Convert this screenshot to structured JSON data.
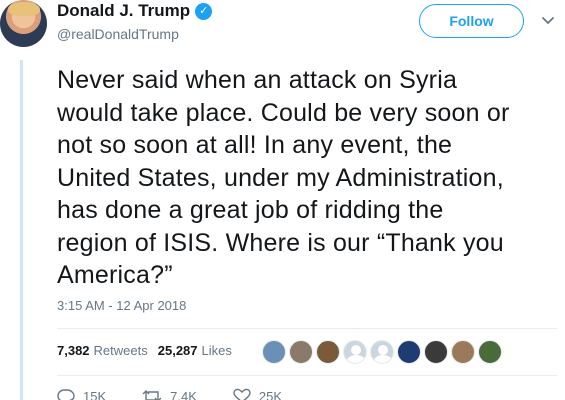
{
  "user": {
    "name": "Donald J. Trump",
    "handle": "@realDonaldTrump",
    "verified_mark": "✓"
  },
  "follow_label": "Follow",
  "tweet": {
    "lines": [
      "Never said when an attack on Syria",
      "would take place. Could be very soon or",
      "not so soon at all! In any event, the",
      "United States, under my Administration,",
      "has done a great job of ridding the",
      "region of ISIS. Where is our “Thank you",
      "America?”"
    ],
    "timestamp": "3:15 AM - 12 Apr 2018"
  },
  "stats": {
    "retweets_count": "7,382",
    "retweets_label": "Retweets",
    "likes_count": "25,287",
    "likes_label": "Likes"
  },
  "likers": [
    {
      "color": "#6b8fb5"
    },
    {
      "color": "#8a7a6a"
    },
    {
      "color": "#7a5a3a"
    },
    {
      "color": "#ccd6dd",
      "default": true
    },
    {
      "color": "#ccd6dd",
      "default": true
    },
    {
      "color": "#1f3b73"
    },
    {
      "color": "#3a3a3a"
    },
    {
      "color": "#9a7a5a"
    },
    {
      "color": "#4a6a3a"
    }
  ],
  "actions": {
    "replies": "15K",
    "retweets": "7.4K",
    "likes": "25K"
  },
  "colors": {
    "accent": "#1da1f2",
    "secondary_text": "#657786",
    "thread_line": "#cfe4f6"
  }
}
